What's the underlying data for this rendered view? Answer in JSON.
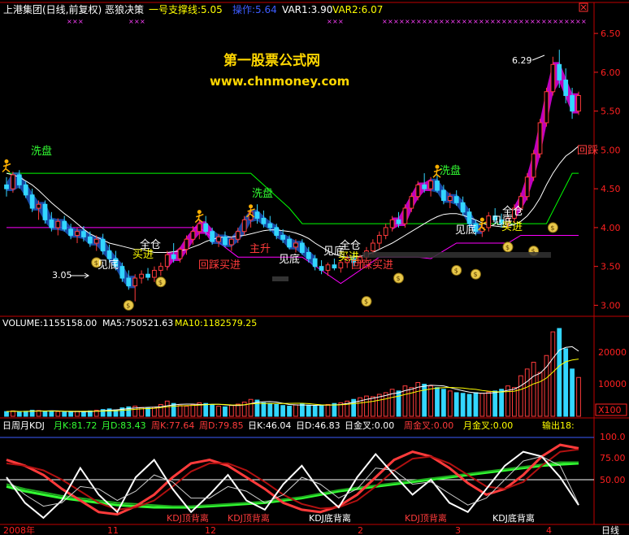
{
  "header": {
    "title": "上港集团(日线,前复权) 恶狼决策",
    "support": "一号支撑线:5.05",
    "op": "操作:5.64",
    "var1": "VAR1:3.90",
    "var2": "VAR2:6.07"
  },
  "watermark": {
    "line1": "第一股票公式网",
    "line2": "www.chnmoney.com"
  },
  "annotations": {
    "high": "6.29",
    "low": "3.05",
    "wash": "洗盘",
    "bottom": "见底",
    "full": "全仓",
    "buy": "买进",
    "pullback": "回踩买进",
    "rise": "主升",
    "side": "回踩"
  },
  "volume": {
    "label": "VOLUME:1155158.00",
    "ma5": "MA5:750521.63",
    "ma10": "MA10:1182579.25",
    "ticks": [
      "20000",
      "10000"
    ],
    "unit": "X100"
  },
  "kdj": {
    "title": "日周月KDJ",
    "mk": "月K:81.72",
    "md": "月D:83.43",
    "wk": "周K:77.64",
    "wd": "周D:79.85",
    "dk": "日K:46.04",
    "dd": "日D:46.83",
    "dgold": "日金叉:0.00",
    "wgold": "周金叉:0.00",
    "mgold": "月金叉:0.00",
    "out": "输出18:",
    "ticks": [
      "100.0",
      "75.00",
      "50.00"
    ],
    "diverge": [
      "KDJ顶背离",
      "KDJ顶背离",
      "KDJ底背离",
      "KDJ顶背离",
      "KDJ底背离"
    ]
  },
  "xaxis": {
    "labels": [
      "2008年",
      "11",
      "12",
      "2",
      "3",
      "4"
    ],
    "mode": "日线"
  },
  "colors": {
    "up": "#ff3b3b",
    "down": "#33d6ff",
    "wash": "#00ff00",
    "support": "#ff00ff",
    "ma": "#ffffff",
    "band": "#1f5fd8",
    "title": "#ffff00",
    "watermark": "#ffd700",
    "axis": "#ff2020"
  },
  "chart_data": {
    "type": "candlestick",
    "ylim": [
      2.9,
      6.7
    ],
    "yticks": [
      6.5,
      6.0,
      5.5,
      5.0,
      4.5,
      4.0,
      3.5,
      3.0
    ],
    "candles": [
      [
        4.55,
        4.65,
        4.4,
        4.5
      ],
      [
        4.5,
        4.72,
        4.45,
        4.68
      ],
      [
        4.68,
        4.74,
        4.5,
        4.55
      ],
      [
        4.55,
        4.6,
        4.38,
        4.42
      ],
      [
        4.42,
        4.5,
        4.2,
        4.25
      ],
      [
        4.25,
        4.35,
        4.1,
        4.3
      ],
      [
        4.3,
        4.35,
        4.05,
        4.1
      ],
      [
        4.1,
        4.2,
        3.95,
        4.0
      ],
      [
        4.0,
        4.12,
        3.9,
        4.08
      ],
      [
        4.08,
        4.15,
        3.95,
        3.98
      ],
      [
        3.98,
        4.05,
        3.85,
        3.9
      ],
      [
        3.9,
        4.0,
        3.8,
        3.95
      ],
      [
        3.95,
        4.02,
        3.82,
        3.88
      ],
      [
        3.88,
        3.95,
        3.75,
        3.8
      ],
      [
        3.8,
        3.9,
        3.7,
        3.85
      ],
      [
        3.85,
        3.92,
        3.65,
        3.7
      ],
      [
        3.7,
        3.78,
        3.55,
        3.6
      ],
      [
        3.6,
        3.7,
        3.45,
        3.5
      ],
      [
        3.5,
        3.55,
        3.3,
        3.35
      ],
      [
        3.35,
        3.45,
        3.2,
        3.25
      ],
      [
        3.25,
        3.4,
        3.05,
        3.35
      ],
      [
        3.35,
        3.45,
        3.28,
        3.4
      ],
      [
        3.4,
        3.48,
        3.32,
        3.36
      ],
      [
        3.36,
        3.5,
        3.3,
        3.45
      ],
      [
        3.45,
        3.55,
        3.38,
        3.5
      ],
      [
        3.5,
        3.7,
        3.45,
        3.65
      ],
      [
        3.65,
        3.8,
        3.55,
        3.6
      ],
      [
        3.6,
        3.75,
        3.55,
        3.72
      ],
      [
        3.72,
        3.9,
        3.65,
        3.85
      ],
      [
        3.85,
        4.02,
        3.78,
        3.95
      ],
      [
        3.95,
        4.1,
        3.85,
        4.05
      ],
      [
        4.05,
        4.15,
        3.9,
        3.95
      ],
      [
        3.95,
        4.0,
        3.78,
        3.82
      ],
      [
        3.82,
        3.92,
        3.75,
        3.88
      ],
      [
        3.88,
        3.95,
        3.75,
        3.78
      ],
      [
        3.78,
        3.88,
        3.7,
        3.85
      ],
      [
        3.85,
        4.0,
        3.8,
        3.95
      ],
      [
        3.95,
        4.15,
        3.9,
        4.1
      ],
      [
        4.1,
        4.25,
        4.0,
        4.2
      ],
      [
        4.2,
        4.3,
        4.05,
        4.12
      ],
      [
        4.12,
        4.22,
        4.0,
        4.05
      ],
      [
        4.05,
        4.15,
        3.95,
        4.0
      ],
      [
        4.0,
        4.05,
        3.85,
        3.9
      ],
      [
        3.9,
        3.98,
        3.8,
        3.85
      ],
      [
        3.85,
        3.9,
        3.72,
        3.75
      ],
      [
        3.75,
        3.85,
        3.68,
        3.8
      ],
      [
        3.8,
        3.85,
        3.65,
        3.68
      ],
      [
        3.68,
        3.75,
        3.55,
        3.6
      ],
      [
        3.6,
        3.65,
        3.45,
        3.5
      ],
      [
        3.5,
        3.58,
        3.4,
        3.45
      ],
      [
        3.45,
        3.55,
        3.38,
        3.52
      ],
      [
        3.52,
        3.6,
        3.45,
        3.48
      ],
      [
        3.48,
        3.58,
        3.42,
        3.55
      ],
      [
        3.55,
        3.65,
        3.48,
        3.6
      ],
      [
        3.6,
        3.68,
        3.5,
        3.55
      ],
      [
        3.55,
        3.65,
        3.48,
        3.62
      ],
      [
        3.62,
        3.75,
        3.55,
        3.7
      ],
      [
        3.7,
        3.85,
        3.65,
        3.8
      ],
      [
        3.8,
        3.95,
        3.72,
        3.9
      ],
      [
        3.9,
        4.05,
        3.85,
        4.0
      ],
      [
        4.0,
        4.15,
        3.95,
        4.1
      ],
      [
        4.1,
        4.2,
        4.0,
        4.05
      ],
      [
        4.05,
        4.3,
        4.0,
        4.25
      ],
      [
        4.25,
        4.45,
        4.2,
        4.4
      ],
      [
        4.4,
        4.6,
        4.35,
        4.55
      ],
      [
        4.55,
        4.7,
        4.45,
        4.5
      ],
      [
        4.5,
        4.65,
        4.4,
        4.6
      ],
      [
        4.6,
        4.68,
        4.45,
        4.48
      ],
      [
        4.48,
        4.55,
        4.3,
        4.35
      ],
      [
        4.35,
        4.45,
        4.25,
        4.4
      ],
      [
        4.4,
        4.48,
        4.28,
        4.32
      ],
      [
        4.32,
        4.4,
        4.15,
        4.2
      ],
      [
        4.2,
        4.25,
        4.0,
        4.05
      ],
      [
        4.05,
        4.1,
        3.9,
        3.95
      ],
      [
        3.95,
        4.05,
        3.88,
        4.0
      ],
      [
        4.0,
        4.2,
        3.95,
        4.15
      ],
      [
        4.15,
        4.25,
        4.05,
        4.1
      ],
      [
        4.1,
        4.18,
        4.0,
        4.05
      ],
      [
        4.05,
        4.15,
        3.98,
        4.12
      ],
      [
        4.12,
        4.3,
        4.05,
        4.25
      ],
      [
        4.25,
        4.45,
        4.2,
        4.4
      ],
      [
        4.4,
        4.7,
        4.35,
        4.65
      ],
      [
        4.65,
        5.0,
        4.6,
        4.95
      ],
      [
        4.95,
        5.4,
        4.9,
        5.35
      ],
      [
        5.35,
        5.8,
        5.3,
        5.75
      ],
      [
        5.75,
        6.2,
        5.7,
        6.1
      ],
      [
        6.1,
        6.29,
        5.8,
        5.9
      ],
      [
        5.9,
        6.05,
        5.6,
        5.7
      ],
      [
        5.7,
        5.8,
        5.4,
        5.5
      ],
      [
        5.5,
        5.75,
        5.45,
        5.7
      ]
    ],
    "ma": [
      4.7,
      4.68,
      4.65,
      4.6,
      4.55,
      4.48,
      4.4,
      4.32,
      4.25,
      4.18,
      4.12,
      4.05,
      3.98,
      3.92,
      3.88,
      3.84,
      3.8,
      3.78,
      3.76,
      3.74,
      3.72,
      3.72,
      3.7,
      3.68,
      3.68,
      3.68,
      3.69,
      3.7,
      3.72,
      3.75,
      3.78,
      3.82,
      3.85,
      3.87,
      3.88,
      3.88,
      3.89,
      3.9,
      3.92,
      3.94,
      3.96,
      3.97,
      3.97,
      3.96,
      3.95,
      3.93,
      3.9,
      3.86,
      3.8,
      3.75,
      3.7,
      3.66,
      3.63,
      3.62,
      3.62,
      3.63,
      3.65,
      3.68,
      3.72,
      3.76,
      3.8,
      3.85,
      3.9,
      3.95,
      4.0,
      4.05,
      4.1,
      4.14,
      4.17,
      4.18,
      4.18,
      4.16,
      4.13,
      4.1,
      4.06,
      4.03,
      4.02,
      4.01,
      4.02,
      4.04,
      4.08,
      4.15,
      4.25,
      4.38,
      4.55,
      4.7,
      4.82,
      4.92,
      4.98,
      5.05
    ],
    "wash_line": [
      [
        0,
        4.7
      ],
      [
        38,
        4.7
      ],
      [
        44,
        4.25
      ],
      [
        46,
        4.05
      ],
      [
        84,
        4.05
      ],
      [
        88,
        4.7
      ],
      [
        89,
        4.7
      ]
    ],
    "support_line": [
      [
        0,
        4.0
      ],
      [
        30,
        4.0
      ],
      [
        36,
        3.62
      ],
      [
        46,
        3.62
      ],
      [
        52,
        3.28
      ],
      [
        58,
        3.62
      ],
      [
        64,
        3.62
      ],
      [
        66,
        3.6
      ],
      [
        70,
        3.8
      ],
      [
        78,
        3.8
      ],
      [
        80,
        3.9
      ],
      [
        89,
        3.9
      ]
    ],
    "volume_ylim": [
      0,
      26000
    ],
    "volume": [
      1400,
      1600,
      1300,
      1500,
      1800,
      1700,
      1500,
      1600,
      1400,
      1200,
      1300,
      1500,
      1400,
      1600,
      1800,
      2000,
      2200,
      1900,
      2500,
      2800,
      3000,
      2600,
      2400,
      2700,
      3500,
      4500,
      3800,
      3200,
      3000,
      3500,
      4000,
      3800,
      3400,
      3000,
      2800,
      3200,
      3600,
      4200,
      5000,
      4800,
      4000,
      3800,
      3500,
      3200,
      3000,
      3400,
      3600,
      3300,
      3000,
      3200,
      3500,
      3800,
      4000,
      4500,
      5000,
      5500,
      6000,
      5800,
      6500,
      7000,
      8000,
      7500,
      9000,
      8500,
      10000,
      9500,
      9000,
      8500,
      8000,
      7500,
      7000,
      6800,
      6500,
      7000,
      6800,
      7200,
      7500,
      8000,
      9000,
      8500,
      12000,
      14000,
      16000,
      13000,
      18000,
      25000,
      26000,
      20000,
      14000,
      11500
    ],
    "kdj_ylim": [
      30,
      110
    ],
    "kdj_series": [
      {
        "name": "月K",
        "values": [
          62,
          58,
          55,
          52,
          50,
          48,
          46,
          45,
          44,
          44,
          44,
          45,
          46,
          47,
          48,
          50,
          52,
          55,
          58,
          60,
          62,
          64,
          66,
          68,
          70,
          72,
          74,
          76,
          78,
          80,
          81,
          82
        ]
      },
      {
        "name": "月D",
        "values": [
          64,
          60,
          57,
          54,
          52,
          50,
          48,
          47,
          46,
          45,
          45,
          46,
          47,
          48,
          49,
          51,
          53,
          56,
          59,
          61,
          63,
          65,
          67,
          69,
          71,
          73,
          75,
          77,
          79,
          81,
          83,
          83
        ]
      },
      {
        "name": "周K",
        "values": [
          85,
          80,
          72,
          60,
          50,
          40,
          38,
          45,
          55,
          70,
          82,
          85,
          80,
          70,
          60,
          48,
          42,
          40,
          45,
          55,
          70,
          85,
          92,
          88,
          78,
          65,
          55,
          60,
          72,
          88,
          98,
          95
        ]
      },
      {
        "name": "周D",
        "values": [
          82,
          80,
          76,
          68,
          58,
          48,
          42,
          44,
          50,
          62,
          75,
          82,
          82,
          76,
          66,
          55,
          47,
          43,
          44,
          50,
          62,
          76,
          86,
          88,
          82,
          72,
          62,
          60,
          66,
          80,
          92,
          94
        ]
      },
      {
        "name": "日K",
        "values": [
          70,
          48,
          35,
          50,
          78,
          55,
          40,
          70,
          85,
          60,
          40,
          55,
          72,
          50,
          42,
          64,
          80,
          58,
          44,
          70,
          90,
          72,
          55,
          68,
          48,
          40,
          60,
          80,
          92,
          88,
          70,
          46
        ]
      },
      {
        "name": "日D",
        "values": [
          68,
          55,
          45,
          48,
          62,
          60,
          50,
          58,
          72,
          66,
          52,
          52,
          62,
          58,
          48,
          55,
          70,
          64,
          52,
          60,
          78,
          76,
          64,
          66,
          56,
          46,
          52,
          68,
          84,
          88,
          80,
          47
        ]
      }
    ]
  }
}
